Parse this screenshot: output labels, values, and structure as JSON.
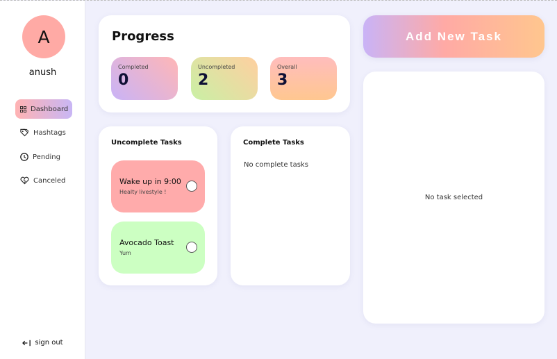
{
  "user": {
    "initial": "A",
    "name": "anush"
  },
  "sidebar": {
    "items": [
      {
        "label": "Dashboard",
        "icon": "grid-icon",
        "active": true
      },
      {
        "label": "Hashtags",
        "icon": "tag-icon",
        "active": false
      },
      {
        "label": "Pending",
        "icon": "clock-icon",
        "active": false
      },
      {
        "label": "Canceled",
        "icon": "heart-broken-icon",
        "active": false
      }
    ],
    "signout_label": "sign out"
  },
  "progress": {
    "title": "Progress",
    "stats": [
      {
        "label": "Completed",
        "value": "0"
      },
      {
        "label": "Uncompleted",
        "value": "2"
      },
      {
        "label": "Overall",
        "value": "3"
      }
    ]
  },
  "uncomplete": {
    "title": "Uncomplete Tasks",
    "tasks": [
      {
        "title": "Wake up in 9:00",
        "description": "Healty livestyle !",
        "color": "#ffabab"
      },
      {
        "title": "Avocado Toast",
        "description": "Yum",
        "color": "#ccffc2"
      }
    ]
  },
  "complete": {
    "title": "Complete Tasks",
    "empty_text": "No complete tasks"
  },
  "add_task_label": "Add New Task",
  "detail": {
    "empty_text": "No task selected"
  },
  "colors": {
    "background": "#f0f0fc",
    "avatar": "#ffaaa5",
    "accent_purple": "#c9b3f7",
    "accent_pink": "#ffaaa5",
    "accent_orange": "#ffc68e"
  }
}
